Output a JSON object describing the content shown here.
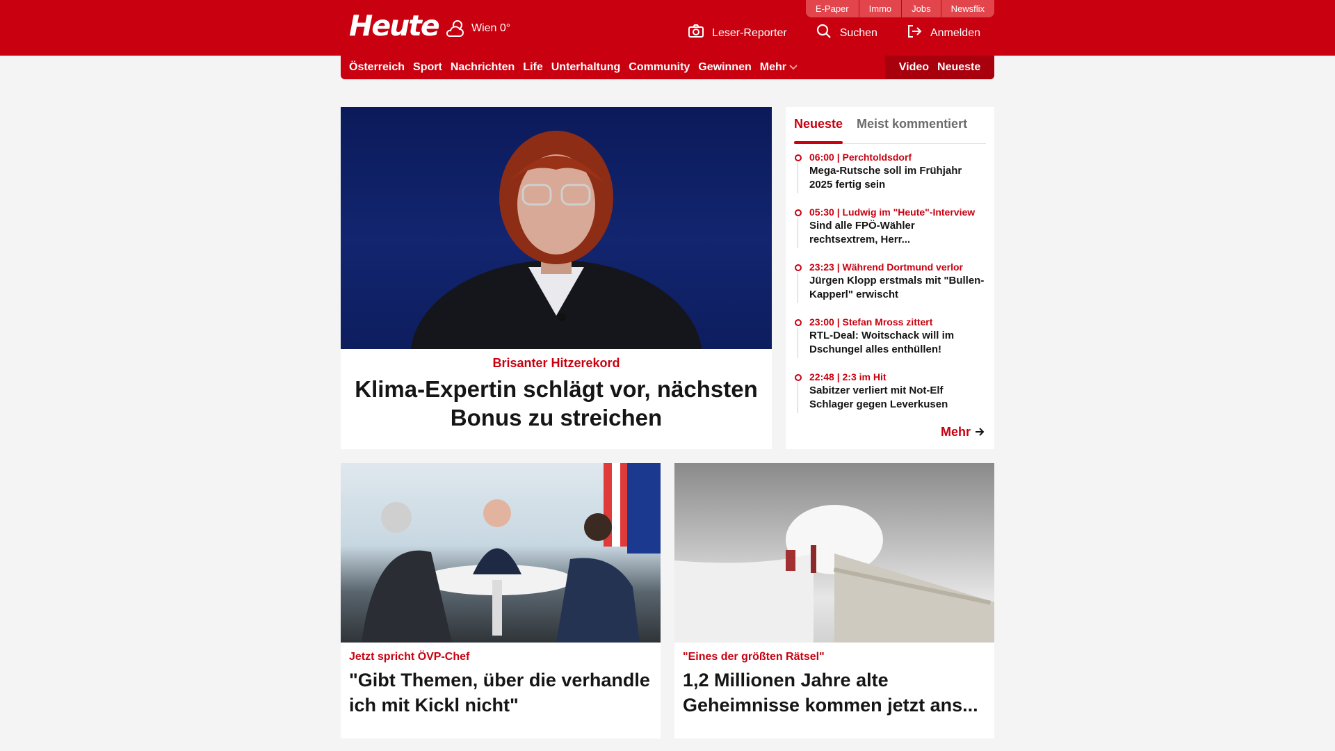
{
  "header": {
    "logo": "Heute",
    "weather": "Wien 0°",
    "top_links": [
      "E-Paper",
      "Immo",
      "Jobs",
      "Newsflix"
    ],
    "utilities": [
      {
        "label": "Leser-Reporter",
        "icon": "camera-icon"
      },
      {
        "label": "Suchen",
        "icon": "search-icon"
      },
      {
        "label": "Anmelden",
        "icon": "login-icon"
      }
    ]
  },
  "nav": {
    "items": [
      "Österreich",
      "Sport",
      "Nachrichten",
      "Life",
      "Unterhaltung",
      "Community",
      "Gewinnen"
    ],
    "more": "Mehr",
    "right": [
      "Video",
      "Neueste"
    ]
  },
  "hero": {
    "kicker": "Brisanter Hitzerekord",
    "title": "Klima-Expertin schlägt vor, nächsten Bonus zu streichen"
  },
  "sidebar": {
    "tabs": [
      "Neueste",
      "Meist kommentiert"
    ],
    "items": [
      {
        "meta": "06:00 | Perchtoldsdorf",
        "title": "Mega-Rutsche soll im Frühjahr 2025 fertig sein"
      },
      {
        "meta": "05:30 | Ludwig im \"Heute\"-Interview",
        "title": "Sind alle FPÖ-Wähler rechtsextrem, Herr..."
      },
      {
        "meta": "23:23 | Während Dortmund verlor",
        "title": "Jürgen Klopp erstmals mit \"Bullen-Kapperl\" erwischt"
      },
      {
        "meta": "23:00 | Stefan Mross zittert",
        "title": "RTL-Deal: Woitschack will im Dschungel alles enthüllen!"
      },
      {
        "meta": "22:48 | 2:3 im Hit",
        "title": "Sabitzer verliert mit Not-Elf Schlager gegen Leverkusen"
      }
    ],
    "more": "Mehr"
  },
  "cards": [
    {
      "kicker": "Jetzt spricht ÖVP-Chef",
      "title": "\"Gibt Themen, über die verhandle ich mit Kickl nicht\""
    },
    {
      "kicker": "\"Eines der größten Rätsel\"",
      "title": "1,2 Millionen Jahre alte Geheimnisse kommen jetzt ans..."
    }
  ],
  "colors": {
    "brand_red": "#c8000f",
    "background": "#f4f4f4"
  }
}
